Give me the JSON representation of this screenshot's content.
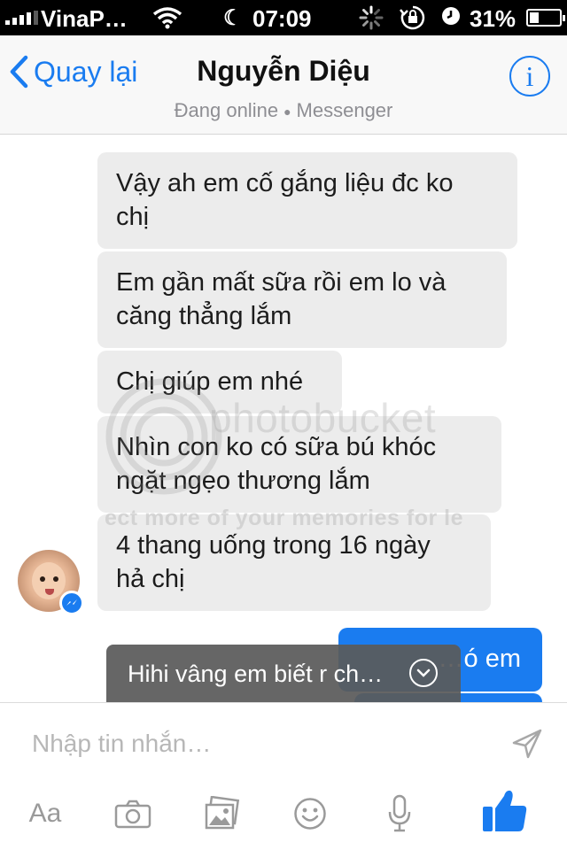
{
  "status_bar": {
    "carrier": "VinaP…",
    "time": "07:09",
    "battery_percent": "31%",
    "battery_level": 0.31
  },
  "nav": {
    "back_label": "Quay lại",
    "title": "Nguyễn Diệu",
    "status": "Đang online",
    "source": "Messenger",
    "info_glyph": "i"
  },
  "messages": [
    {
      "side": "in",
      "lines": [
        "Vậy ah em cố gắng liệu đc ko",
        "chị"
      ]
    },
    {
      "side": "in",
      "lines": [
        "Em gần mất sữa rồi em lo và",
        "căng thẳng lắm"
      ]
    },
    {
      "side": "in",
      "lines": [
        "Chị giúp em nhé"
      ]
    },
    {
      "side": "in",
      "lines": [
        "Nhìn con ko có sữa bú khóc",
        "ngặt ngẹo thương lắm"
      ]
    },
    {
      "side": "in",
      "lines": [
        "4 thang uống trong 16 ngày",
        "hả chị"
      ]
    },
    {
      "side": "out",
      "lines": [
        "…ó em"
      ]
    }
  ],
  "watermark": {
    "brand": "photobucket",
    "tagline": "ect more of your memories for le"
  },
  "toast": {
    "text": "Hihi vâng em biết r ch…"
  },
  "composer": {
    "placeholder": "Nhập tin nhắn…",
    "aa_label": "Aa",
    "icons": [
      "font-size-icon",
      "camera-icon",
      "photo-gallery-icon",
      "emoji-icon",
      "microphone-icon",
      "thumbs-up-icon"
    ]
  },
  "colors": {
    "accent": "#1a7cf0",
    "incoming_bubble": "#ececec",
    "status_bar": "#000000"
  }
}
